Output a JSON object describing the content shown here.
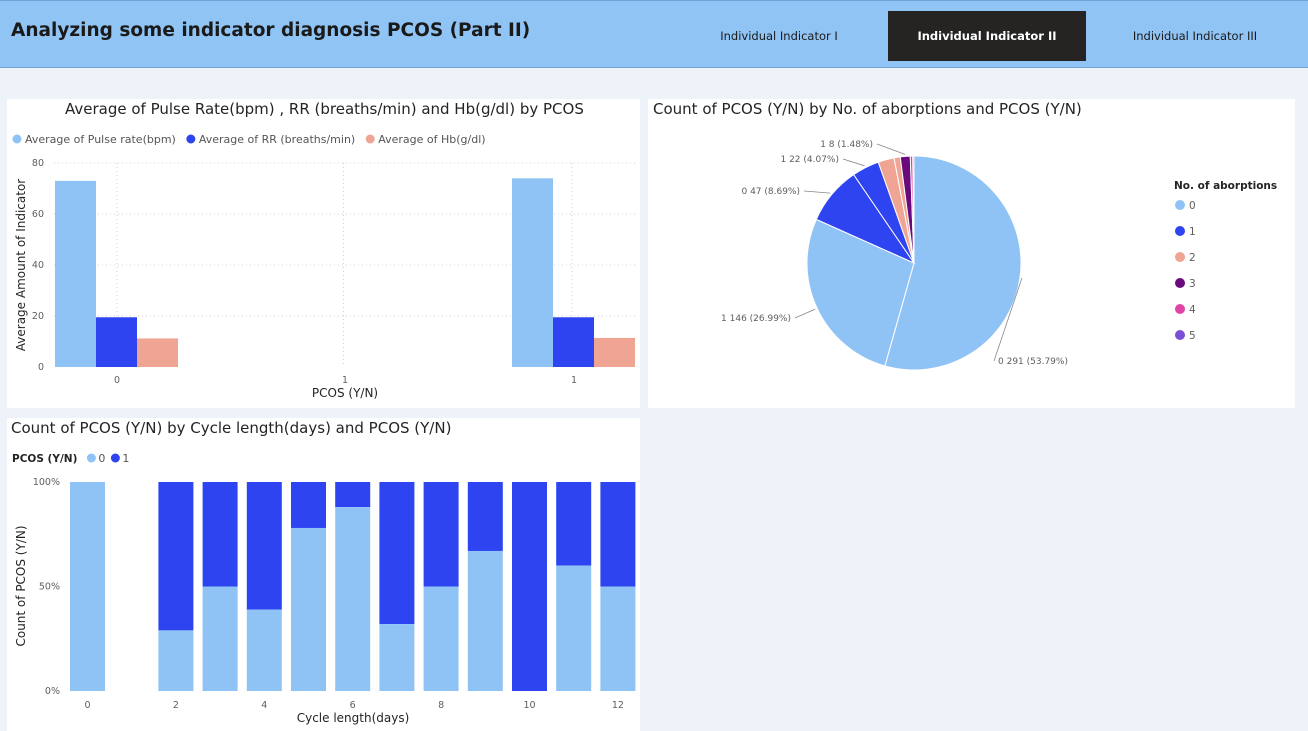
{
  "header": {
    "title": "Analyzing some indicator diagnosis PCOS (Part II)",
    "nav": [
      {
        "label": "Individual Indicator I",
        "active": false
      },
      {
        "label": "Individual Indicator II",
        "active": true
      },
      {
        "label": "Individual Indicator III",
        "active": false
      }
    ]
  },
  "colors": {
    "light_blue": "#8fc3f5",
    "dark_blue": "#2d44f0",
    "salmon": "#f0a594",
    "purple_dark": "#6b0a7a",
    "pink": "#e044a7",
    "violet": "#7b4fd4",
    "header_bg": "#90c4f5",
    "active_nav_bg": "#252423"
  },
  "chart_data": [
    {
      "id": "bar",
      "type": "bar",
      "title": "Average of Pulse Rate(bpm) , RR (breaths/min) and Hb(g/dl) by PCOS",
      "xlabel": "PCOS (Y/N)",
      "ylabel": "Average Amount of Indicator",
      "ylim": [
        0,
        80
      ],
      "yticks": [
        "0",
        "20",
        "40",
        "60",
        "80"
      ],
      "categories": [
        "0",
        "1"
      ],
      "mid_tick_label": "1",
      "grid": true,
      "legend_position": "top-left",
      "series": [
        {
          "name": "Average of Pulse rate(bpm)",
          "values": [
            73,
            74
          ],
          "color": "#8fc3f5"
        },
        {
          "name": "Average of RR (breaths/min)",
          "values": [
            19.5,
            19.5
          ],
          "color": "#2d44f0"
        },
        {
          "name": "Average of Hb(g/dl)",
          "values": [
            11.2,
            11.4
          ],
          "color": "#f0a594"
        }
      ]
    },
    {
      "id": "pie",
      "type": "pie",
      "title": "Count of PCOS (Y/N) by No. of aborptions and PCOS (Y/N)",
      "legend_title": "No. of aborptions",
      "legend_position": "right",
      "legend": [
        {
          "label": "0",
          "color": "#8fc3f5"
        },
        {
          "label": "1",
          "color": "#2d44f0"
        },
        {
          "label": "2",
          "color": "#f0a594"
        },
        {
          "label": "3",
          "color": "#6b0a7a"
        },
        {
          "label": "4",
          "color": "#e044a7"
        },
        {
          "label": "5",
          "color": "#7b4fd4"
        }
      ],
      "slices": [
        {
          "group": "0",
          "pcos": "0",
          "value": 291,
          "pct": 53.79,
          "color": "#8fc3f5",
          "label": "0 291 (53.79%)"
        },
        {
          "group": "1",
          "pcos": "0",
          "value": 146,
          "pct": 26.99,
          "color": "#8fc3f5",
          "label": "1 146 (26.99%)"
        },
        {
          "group": "0",
          "pcos": "1",
          "value": 47,
          "pct": 8.69,
          "color": "#2d44f0",
          "label": "0 47 (8.69%)"
        },
        {
          "group": "1",
          "pcos": "1",
          "value": 22,
          "pct": 4.07,
          "color": "#2d44f0",
          "label": "1 22 (4.07%)"
        },
        {
          "group": "2",
          "pcos": "0",
          "value": 13,
          "pct": 2.4,
          "color": "#f0a594",
          "label": ""
        },
        {
          "group": "2",
          "pcos": "1",
          "value": 5,
          "pct": 0.92,
          "color": "#f0a594",
          "label": ""
        },
        {
          "group": "3",
          "pcos": "1",
          "value": 8,
          "pct": 1.48,
          "color": "#6b0a7a",
          "label": "1 8 (1.48%)"
        },
        {
          "group": "4",
          "pcos": "0",
          "value": 2,
          "pct": 0.37,
          "color": "#e044a7",
          "label": ""
        },
        {
          "group": "5",
          "pcos": "0",
          "value": 1,
          "pct": 0.18,
          "color": "#7b4fd4",
          "label": ""
        }
      ]
    },
    {
      "id": "stacked",
      "type": "bar",
      "stacked_percent": true,
      "title": "Count of PCOS (Y/N) by Cycle length(days) and PCOS (Y/N)",
      "xlabel": "Cycle length(days)",
      "ylabel": "Count of PCOS (Y/N)",
      "legend_title": "PCOS (Y/N)",
      "legend_position": "top-left",
      "yticks": [
        "0%",
        "50%",
        "100%"
      ],
      "xticks": [
        "0",
        "2",
        "4",
        "6",
        "8",
        "10",
        "12"
      ],
      "categories": [
        "0",
        "1",
        "2",
        "3",
        "4",
        "5",
        "6",
        "7",
        "8",
        "9",
        "10",
        "11",
        "12"
      ],
      "series": [
        {
          "name": "0",
          "color": "#8fc3f5",
          "values": [
            100,
            null,
            29,
            50,
            39,
            78,
            88,
            32,
            50,
            67,
            0,
            60,
            50
          ]
        },
        {
          "name": "1",
          "color": "#2d44f0",
          "values": [
            0,
            null,
            71,
            50,
            61,
            22,
            12,
            68,
            50,
            33,
            100,
            40,
            50
          ]
        }
      ]
    }
  ]
}
